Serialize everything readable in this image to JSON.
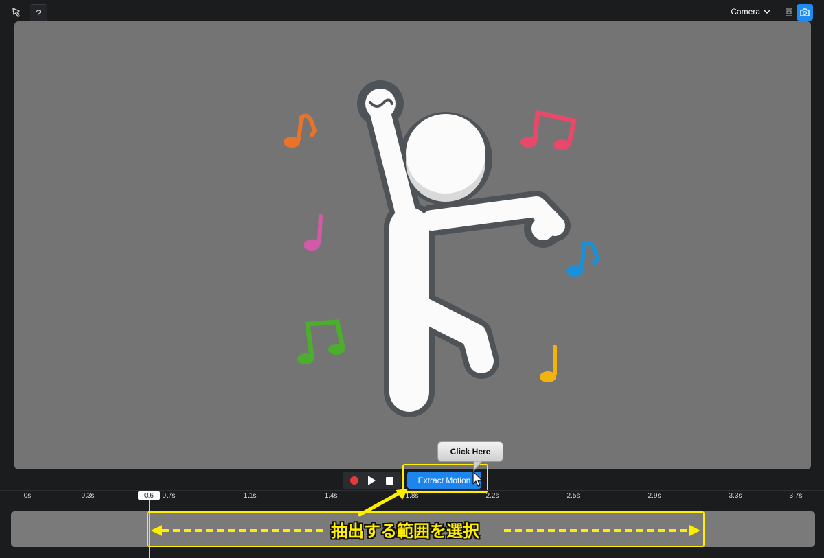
{
  "toolbar": {
    "help_label": "?",
    "camera_label": "Camera",
    "icons": [
      "pen-tool-icon",
      "help-icon",
      "chevron-down-icon",
      "fit-icon",
      "camera-icon"
    ]
  },
  "controls": {
    "extract_label": "Extract Motion",
    "tooltip_label": "Click Here"
  },
  "timeline": {
    "playhead_value": "0.6",
    "ticks": [
      "0s",
      "0.3s",
      "0.7s",
      "1.1s",
      "1.4s",
      "1.8s",
      "2.2s",
      "2.5s",
      "2.9s",
      "3.3s",
      "3.7s"
    ]
  },
  "annotation": {
    "range_label": "抽出する範囲を選択"
  },
  "colors": {
    "accent": "#1c86ee",
    "record": "#e8373d",
    "highlight": "#ffee00",
    "viewport": "#747474",
    "notes": [
      "#e8742a",
      "#e8486a",
      "#d25ba8",
      "#1b90d8",
      "#4cae2e",
      "#f3b30e"
    ]
  }
}
